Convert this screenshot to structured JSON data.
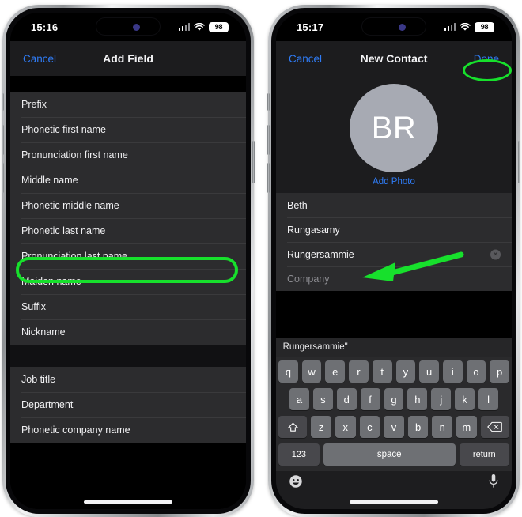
{
  "left_phone": {
    "status_bar": {
      "time": "15:16",
      "battery": "98",
      "focus_icon": "focus-indicator-icon",
      "signal_icon": "cellular-signal-icon",
      "wifi_icon": "wifi-icon"
    },
    "nav": {
      "cancel_label": "Cancel",
      "title": "Add Field"
    },
    "sections": [
      {
        "rows": [
          "Prefix",
          "Phonetic first name",
          "Pronunciation first name",
          "Middle name",
          "Phonetic middle name",
          "Phonetic last name",
          "Pronunciation last name",
          "Maiden name",
          "Suffix",
          "Nickname"
        ]
      },
      {
        "rows": [
          "Job title",
          "Department",
          "Phonetic company name"
        ]
      }
    ],
    "highlighted_row": "Pronunciation last name"
  },
  "right_phone": {
    "status_bar": {
      "time": "15:17",
      "battery": "98",
      "focus_icon": "focus-indicator-icon",
      "signal_icon": "cellular-signal-icon",
      "wifi_icon": "wifi-icon"
    },
    "nav": {
      "cancel_label": "Cancel",
      "title": "New Contact",
      "done_label": "Done"
    },
    "avatar": {
      "initials": "BR",
      "add_photo_label": "Add Photo"
    },
    "fields": [
      {
        "value": "Beth",
        "placeholder": false,
        "clear": false
      },
      {
        "value": "Rungasamy",
        "placeholder": false,
        "clear": false
      },
      {
        "value": "Rungersammie",
        "placeholder": false,
        "clear": true
      },
      {
        "value": "Company",
        "placeholder": true,
        "clear": false
      }
    ],
    "keyboard": {
      "predictive": [
        "Rungersammie\"",
        "",
        ""
      ],
      "row1": [
        "q",
        "w",
        "e",
        "r",
        "t",
        "y",
        "u",
        "i",
        "o",
        "p"
      ],
      "row2": [
        "a",
        "s",
        "d",
        "f",
        "g",
        "h",
        "j",
        "k",
        "l"
      ],
      "row3": [
        "z",
        "x",
        "c",
        "v",
        "b",
        "n",
        "m"
      ],
      "shift_icon": "shift-key-icon",
      "delete_icon": "delete-key-icon",
      "numbers_label": "123",
      "space_label": "space",
      "return_label": "return",
      "emoji_icon": "emoji-key-icon",
      "dictation_icon": "microphone-key-icon"
    }
  },
  "annotations": {
    "highlight_color": "#17e02c",
    "field_oval_target": "Pronunciation last name",
    "done_oval_target": "Done",
    "arrow_target": "Rungersammie"
  }
}
